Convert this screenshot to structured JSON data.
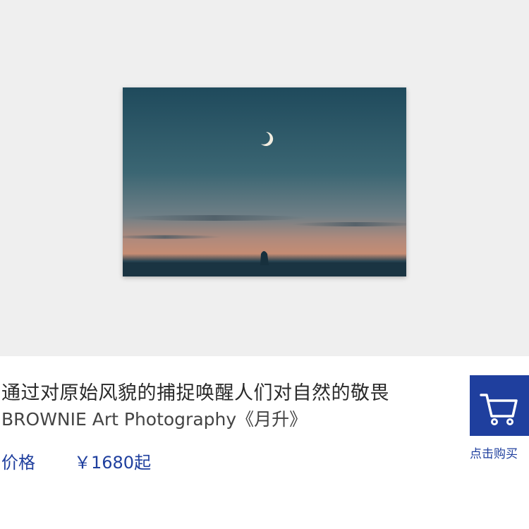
{
  "product": {
    "title": "通过对原始风貌的捕捉唤醒人们对自然的敬畏",
    "subtitle": "BROWNIE Art Photography《月升》",
    "price_label": "价格",
    "price_value": "￥1680起"
  },
  "actions": {
    "buy_label": "点击购买"
  },
  "colors": {
    "accent": "#1f3f9e",
    "hero_background": "#efefef"
  },
  "icons": {
    "cart": "shopping-cart-icon"
  }
}
